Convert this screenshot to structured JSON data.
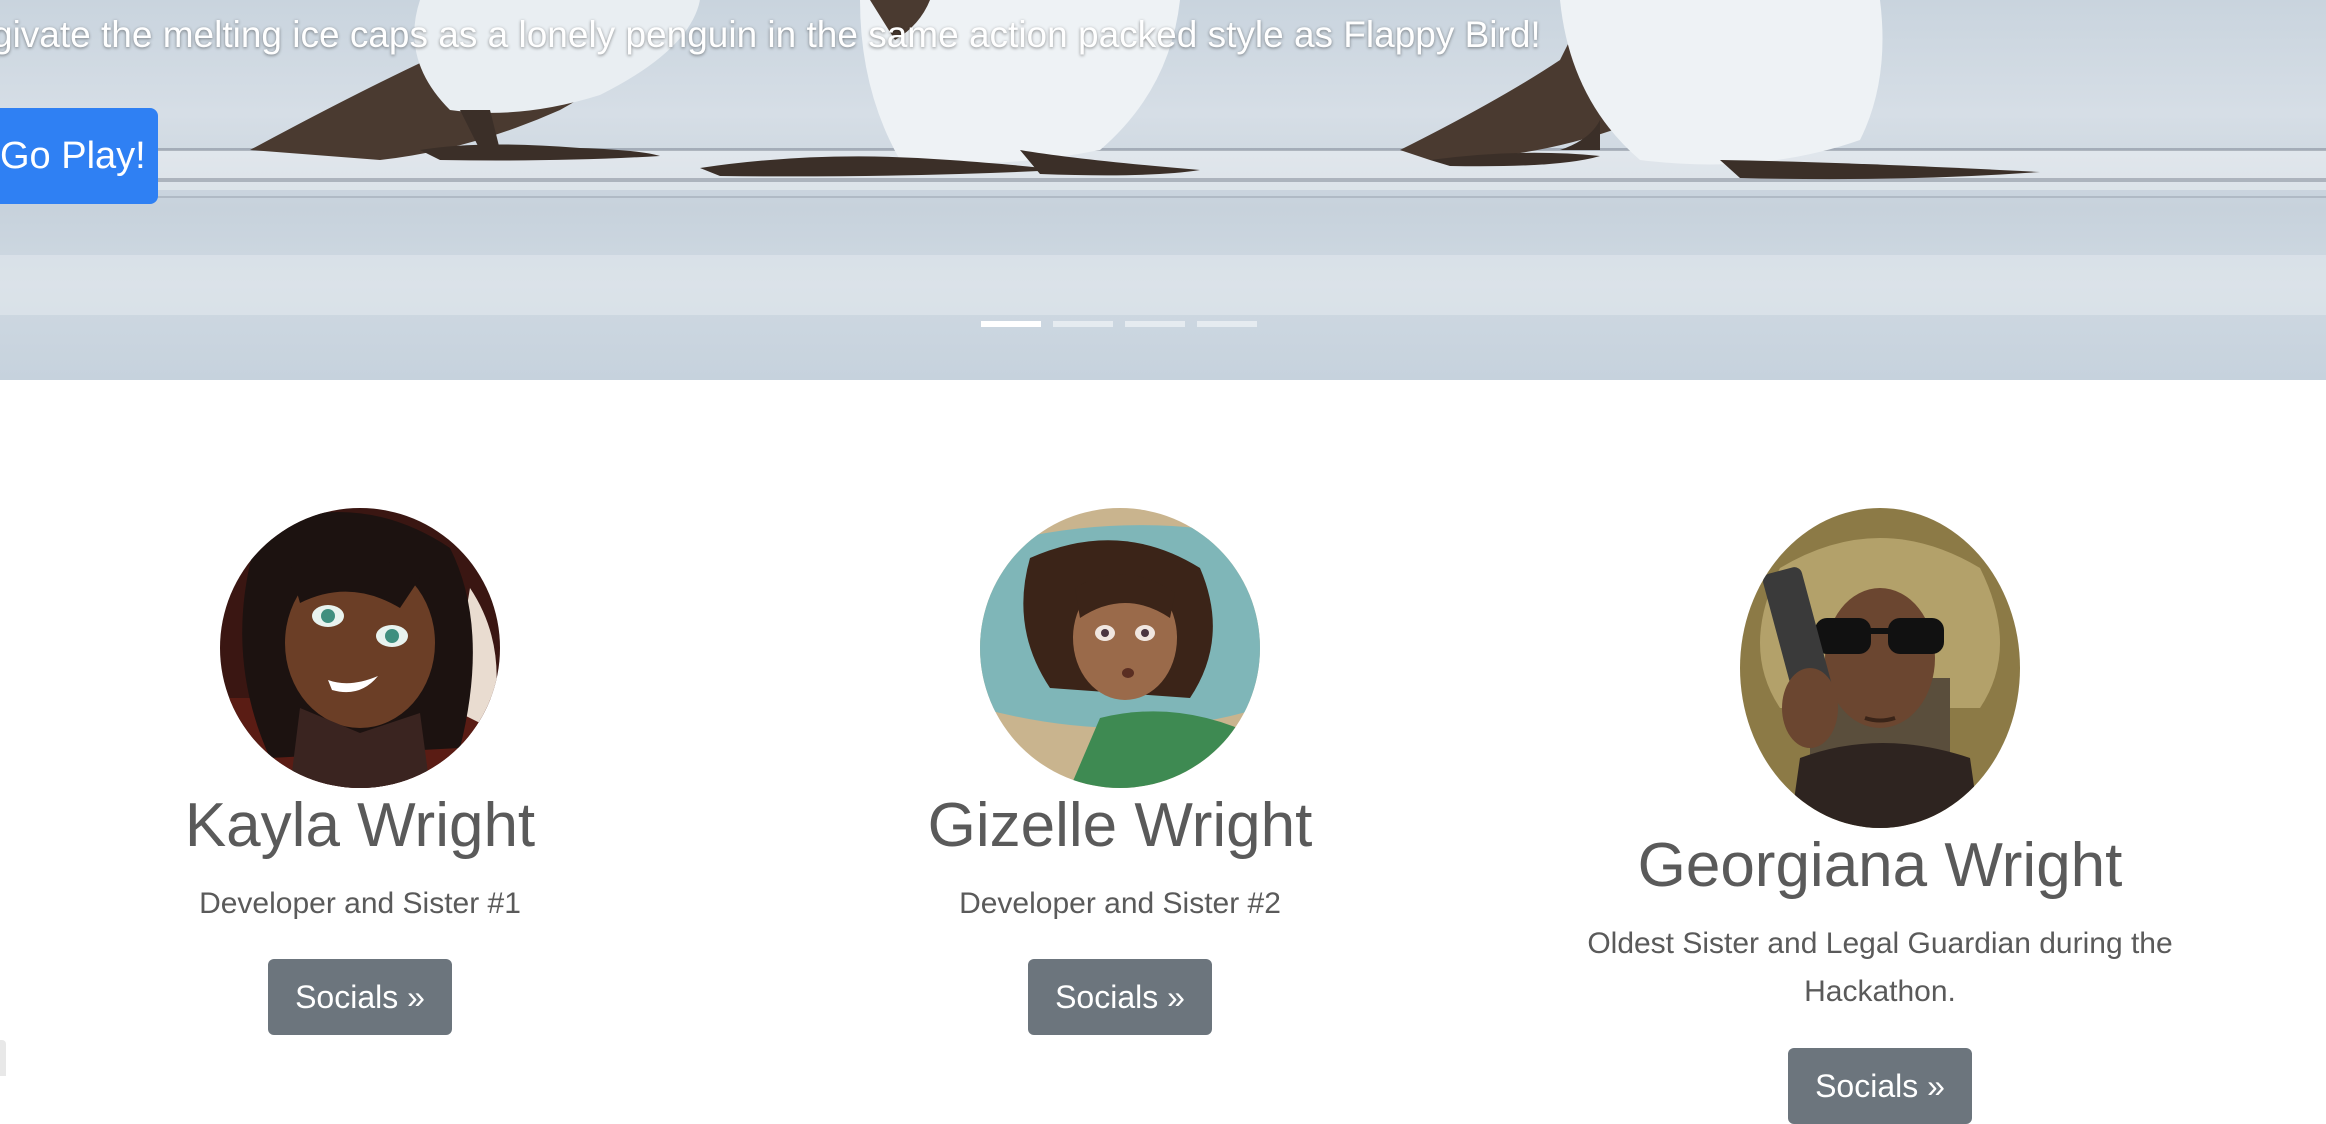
{
  "hero": {
    "caption": "givate the melting ice caps as a lonely penguin in the same action packed style as Flappy Bird!",
    "button_label": "Go Play!",
    "indicator_count": 4,
    "active_indicator": 0
  },
  "team": {
    "members": [
      {
        "name": "Kayla Wright",
        "role": "Developer and Sister #1",
        "button_label": "Socials »"
      },
      {
        "name": "Gizelle Wright",
        "role": "Developer and Sister #2",
        "button_label": "Socials »"
      },
      {
        "name": "Georgiana Wright",
        "role": "Oldest Sister and Legal Guardian during the Hackathon.",
        "button_label": "Socials »"
      }
    ]
  },
  "colors": {
    "primary": "#2f80f3",
    "secondary": "#6c757d",
    "text": "#5a5a5a"
  }
}
